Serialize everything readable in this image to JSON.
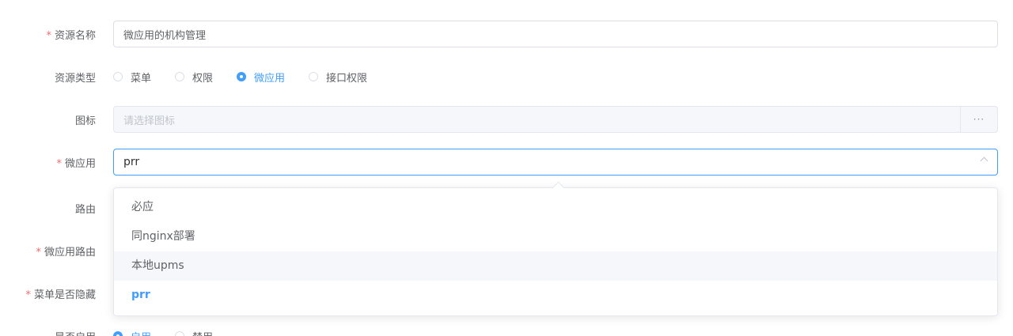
{
  "form": {
    "resource_name": {
      "label": "资源名称",
      "required": true,
      "value": "微应用的机构管理"
    },
    "resource_type": {
      "label": "资源类型",
      "options": [
        "菜单",
        "权限",
        "微应用",
        "接口权限"
      ],
      "selected": "微应用"
    },
    "icon": {
      "label": "图标",
      "placeholder": "请选择图标",
      "append": "···"
    },
    "micro_app": {
      "label": "微应用",
      "required": true,
      "value": "prr"
    },
    "route": {
      "label": "路由"
    },
    "micro_app_route": {
      "label": "微应用路由",
      "required": true
    },
    "menu_hidden": {
      "label": "菜单是否隐藏",
      "required": true
    },
    "enabled": {
      "label": "是否启用",
      "options": [
        "启用",
        "禁用"
      ],
      "selected": "启用"
    }
  },
  "dropdown": {
    "options": [
      {
        "label": "必应"
      },
      {
        "label": "同nginx部署"
      },
      {
        "label": "本地upms"
      },
      {
        "label": "prr"
      }
    ],
    "hover_index": 2,
    "selected_index": 3
  },
  "colors": {
    "primary": "#409eff",
    "required": "#f56c6c"
  }
}
